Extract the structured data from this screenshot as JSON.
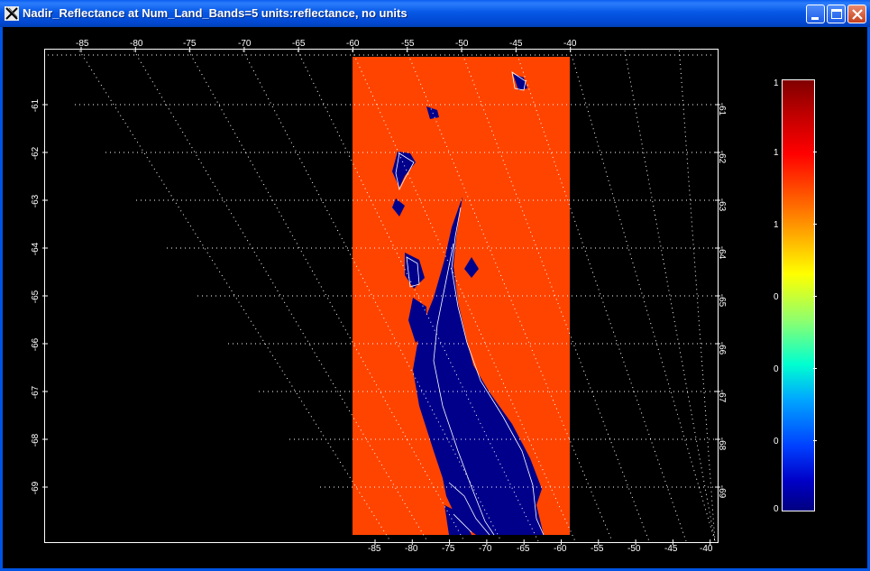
{
  "window": {
    "title": "Nadir_Reflectance at Num_Land_Bands=5  units:reflectance, no units",
    "app_icon": "x-window-icon"
  },
  "plot": {
    "top_lon_labels": [
      "-85",
      "-80",
      "-75",
      "-70",
      "-65",
      "-60",
      "-55",
      "-50",
      "-45",
      "-40"
    ],
    "bottom_lon_labels": [
      "-85",
      "-80",
      "-75",
      "-70",
      "-65",
      "-60",
      "-55",
      "-50",
      "-45",
      "-40"
    ],
    "left_lat_labels": [
      "-61",
      "-62",
      "-63",
      "-64",
      "-65",
      "-66",
      "-67",
      "-68",
      "-69"
    ],
    "right_lat_labels": [
      "-61",
      "-62",
      "-63",
      "-64",
      "-65",
      "-66",
      "-67",
      "-68",
      "-69"
    ],
    "grid_color": "#ffffff",
    "background_color": "#000000",
    "scene_fill_color": "#ff4400",
    "land_color": "#00008b"
  },
  "colorbar": {
    "labels": [
      "1",
      "1",
      "1",
      "0",
      "0",
      "0",
      "0"
    ]
  }
}
